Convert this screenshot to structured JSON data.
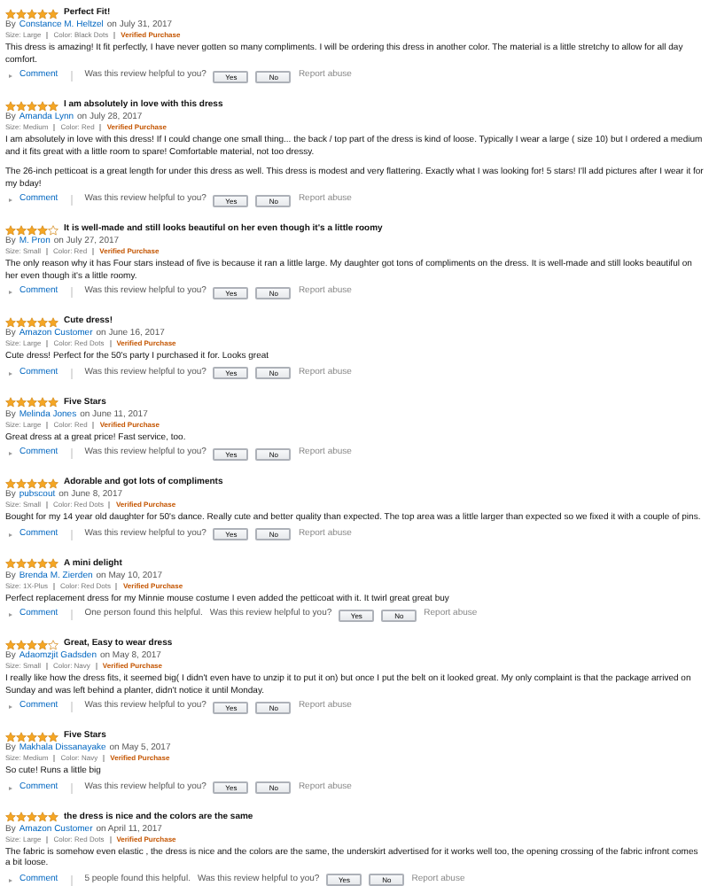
{
  "reviews": [
    {
      "stars": 5,
      "title": "Perfect Fit!",
      "by": "By",
      "author": "Constance M. Heltzel",
      "date": "on July 31, 2017",
      "size_label": "Size: Large",
      "color_label": "Color: Black Dots",
      "verified": "Verified Purchase",
      "body": [
        "This dress is amazing! It fit perfectly, I have never gotten so many compliments. I will be ordering this dress in another color. The material is a little stretchy to allow for all day comfort."
      ],
      "comment": "Comment",
      "prompt": "Was this review helpful to you?",
      "yes": "Yes",
      "no": "No",
      "report": "Report abuse"
    },
    {
      "stars": 5,
      "title": "I am absolutely in love with this dress",
      "by": "By",
      "author": "Amanda Lynn",
      "date": "on July 28, 2017",
      "size_label": "Size: Medium",
      "color_label": "Color: Red",
      "verified": "Verified Purchase",
      "body": [
        "I am absolutely in love with this dress! If I could change one small thing... the back / top part of the dress is kind of loose. Typically I wear a large ( size 10) but I ordered a medium and it fits great with a little room to spare! Comfortable material, not too dressy.",
        "The 26-inch petticoat is a great length for under this dress as well. This dress is modest and very flattering. Exactly what I was looking for! 5 stars! I'll add pictures after I wear it for my bday!"
      ],
      "comment": "Comment",
      "prompt": "Was this review helpful to you?",
      "yes": "Yes",
      "no": "No",
      "report": "Report abuse"
    },
    {
      "stars": 4,
      "title": "It is well-made and still looks beautiful on her even though it's a little roomy",
      "by": "By",
      "author": "M. Pron",
      "date": "on July 27, 2017",
      "size_label": "Size: Small",
      "color_label": "Color: Red",
      "verified": "Verified Purchase",
      "body": [
        "The only reason why it has Four stars instead of five is because it ran a little large. My daughter got tons of compliments on the dress. It is well-made and still looks beautiful on her even though it's a little roomy."
      ],
      "comment": "Comment",
      "prompt": "Was this review helpful to you?",
      "yes": "Yes",
      "no": "No",
      "report": "Report abuse"
    },
    {
      "stars": 5,
      "title": "Cute dress!",
      "by": "By",
      "author": "Amazon Customer",
      "date": "on June 16, 2017",
      "size_label": "Size: Large",
      "color_label": "Color: Red Dots",
      "verified": "Verified Purchase",
      "body": [
        "Cute dress! Perfect for the 50's party I purchased it for. Looks great"
      ],
      "comment": "Comment",
      "prompt": "Was this review helpful to you?",
      "yes": "Yes",
      "no": "No",
      "report": "Report abuse"
    },
    {
      "stars": 5,
      "title": "Five Stars",
      "by": "By",
      "author": "Melinda Jones",
      "date": "on June 11, 2017",
      "size_label": "Size: Large",
      "color_label": "Color: Red",
      "verified": "Verified Purchase",
      "body": [
        "Great dress at a great price! Fast service, too."
      ],
      "comment": "Comment",
      "prompt": "Was this review helpful to you?",
      "yes": "Yes",
      "no": "No",
      "report": "Report abuse"
    },
    {
      "stars": 5,
      "title": "Adorable and got lots of compliments",
      "by": "By",
      "author": "pubscout",
      "date": "on June 8, 2017",
      "size_label": "Size: Small",
      "color_label": "Color: Red Dots",
      "verified": "Verified Purchase",
      "body": [
        "Bought for my 14 year old daughter for 50's dance. Really cute and better quality than expected. The top area was a little larger than expected so we fixed it with a couple of pins."
      ],
      "comment": "Comment",
      "prompt": "Was this review helpful to you?",
      "yes": "Yes",
      "no": "No",
      "report": "Report abuse"
    },
    {
      "stars": 5,
      "title": "A mini delight",
      "by": "By",
      "author": "Brenda M. Zierden",
      "date": "on May 10, 2017",
      "size_label": "Size: 1X-Plus",
      "color_label": "Color: Red Dots",
      "verified": "Verified Purchase",
      "body": [
        "Perfect replacement dress for my Minnie mouse costume I even added the petticoat with it. It twirl great great buy"
      ],
      "comment": "Comment",
      "found": "One person found this helpful.",
      "prompt": "Was this review helpful to you?",
      "yes": "Yes",
      "no": "No",
      "report": "Report abuse"
    },
    {
      "stars": 4,
      "title": "Great, Easy to wear dress",
      "by": "By",
      "author": "Adaomzjit Gadsden",
      "date": "on May 8, 2017",
      "size_label": "Size: Small",
      "color_label": "Color: Navy",
      "verified": "Verified Purchase",
      "body": [
        "I really like how the dress fits, it seemed big( I didn't even have to unzip it to put it on) but once I put the belt on it looked great. My only complaint is that the package arrived on Sunday and was left behind a planter, didn't notice it until Monday."
      ],
      "comment": "Comment",
      "prompt": "Was this review helpful to you?",
      "yes": "Yes",
      "no": "No",
      "report": "Report abuse"
    },
    {
      "stars": 5,
      "title": "Five Stars",
      "by": "By",
      "author": "Makhala Dissanayake",
      "date": "on May 5, 2017",
      "size_label": "Size: Medium",
      "color_label": "Color: Navy",
      "verified": "Verified Purchase",
      "body": [
        "So cute! Runs a little big"
      ],
      "comment": "Comment",
      "prompt": "Was this review helpful to you?",
      "yes": "Yes",
      "no": "No",
      "report": "Report abuse"
    },
    {
      "stars": 5,
      "title": "the dress is nice and the colors are the same",
      "by": "By",
      "author": "Amazon Customer",
      "date": "on April 11, 2017",
      "size_label": "Size: Large",
      "color_label": "Color: Red Dots",
      "verified": "Verified Purchase",
      "body": [
        "The fabric is somehow even elastic , the dress is nice and the colors are the same, the underskirt advertised for it works well too, the opening crossing of the fabric infront comes a bit loose."
      ],
      "comment": "Comment",
      "found": "5 people found this helpful.",
      "prompt": "Was this review helpful to you?",
      "yes": "Yes",
      "no": "No",
      "report": "Report abuse"
    }
  ]
}
